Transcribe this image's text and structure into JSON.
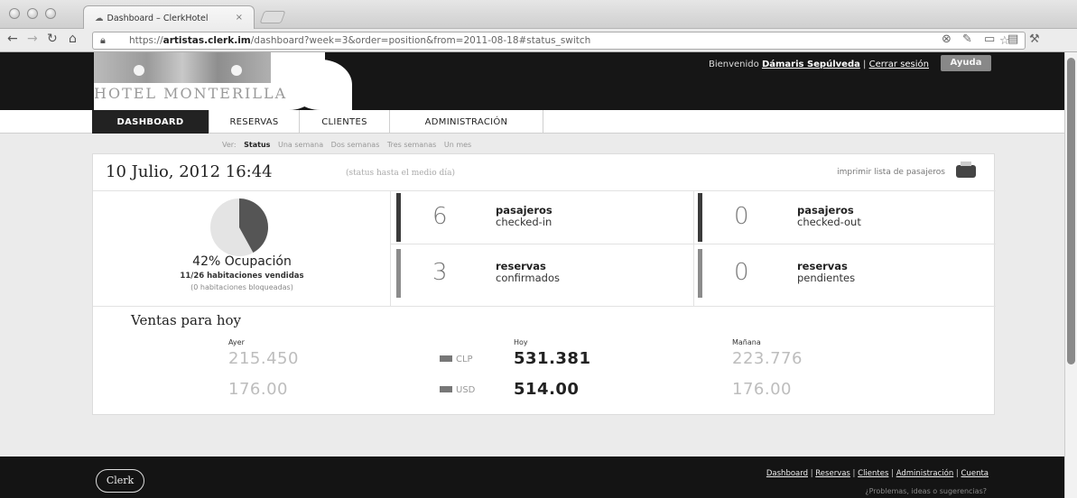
{
  "browser": {
    "tab_title": "Dashboard – ClerkHotel",
    "tab_close": "×",
    "url_scheme": "https://",
    "url_host": "artistas.clerk.im",
    "url_path": "/dashboard?week=3&order=position&from=2011-08-18#status_switch"
  },
  "header": {
    "hotel_name": "HOTEL MONTERILLA",
    "welcome_prefix": "Bienvenido",
    "user_name": "Dámaris Sepúlveda",
    "separator": "|",
    "logout": "Cerrar sesión",
    "help": "Ayuda"
  },
  "menu": {
    "items": [
      {
        "label": "DASHBOARD",
        "active": true
      },
      {
        "label": "RESERVAS"
      },
      {
        "label": "CLIENTES"
      },
      {
        "label": "ADMINISTRACIÓN"
      }
    ]
  },
  "view": {
    "prefix": "Ver:",
    "options": [
      "Status",
      "Una semana",
      "Dos semanas",
      "Tres semanas",
      "Un mes"
    ],
    "current": "Status"
  },
  "status": {
    "date": "10 Julio, 2012 16:44",
    "date_note": "(status hasta el medio día)",
    "print_link": "imprimir lista de pasajeros"
  },
  "occupancy": {
    "title": "42% Ocupación",
    "percent": 42,
    "rooms_sold": "11/26 habitaciones vendidas",
    "rooms_blocked": "(0 habitaciones bloqueadas)"
  },
  "stats": [
    {
      "number": "6",
      "line1": "pasajeros",
      "line2": "checked-in"
    },
    {
      "number": "0",
      "line1": "pasajeros",
      "line2": "checked-out"
    },
    {
      "number": "3",
      "line1": "reservas",
      "line2": "confirmados"
    },
    {
      "number": "0",
      "line1": "reservas",
      "line2": "pendientes"
    }
  ],
  "sales": {
    "title": "Ventas para hoy",
    "yesterday": {
      "caption": "Ayer",
      "clp": "215.450",
      "usd": "176.00"
    },
    "today": {
      "caption": "Hoy",
      "clp": "531.381",
      "usd": "514.00"
    },
    "tomorrow": {
      "caption": "Mañana",
      "clp": "223.776",
      "usd": "176.00"
    },
    "currency_clp": "CLP",
    "currency_usd": "USD"
  },
  "footer": {
    "logo": "Clerk",
    "links": [
      "Dashboard",
      "Reservas",
      "Clientes",
      "Administración",
      "Cuenta"
    ],
    "sub": "¿Problemas, ideas o sugerencias?"
  },
  "colors": {
    "header_bg": "#161616",
    "pie_filled": "#555555",
    "pie_empty": "#e4e4e4"
  }
}
